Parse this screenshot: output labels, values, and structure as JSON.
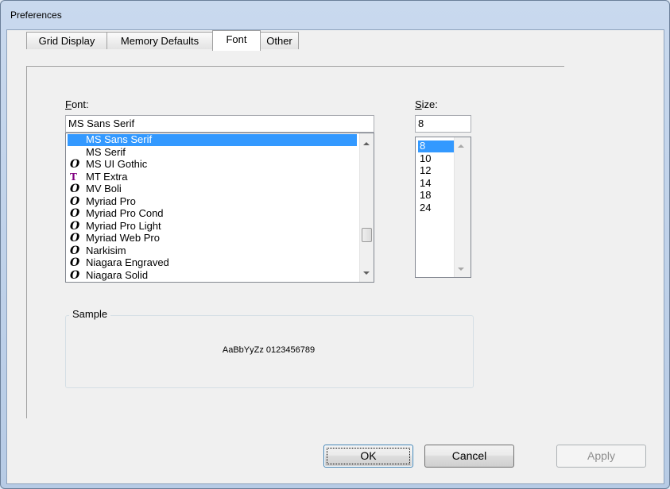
{
  "window": {
    "title": "Preferences"
  },
  "tabs": [
    {
      "label": "Grid Display"
    },
    {
      "label": "Memory Defaults"
    },
    {
      "label": "Font",
      "active": true
    },
    {
      "label": "Other"
    }
  ],
  "font": {
    "label_underlined": "F",
    "label_rest": "ont:",
    "value": "MS Sans Serif",
    "items": [
      {
        "name": "MS Sans Serif",
        "icon": "",
        "selected": true
      },
      {
        "name": "MS Serif",
        "icon": ""
      },
      {
        "name": "MS UI Gothic",
        "icon": "opentype-icon"
      },
      {
        "name": "MT Extra",
        "icon": "truetype-icon"
      },
      {
        "name": "MV Boli",
        "icon": "opentype-icon"
      },
      {
        "name": "Myriad Pro",
        "icon": "opentype-icon"
      },
      {
        "name": "Myriad Pro Cond",
        "icon": "opentype-icon"
      },
      {
        "name": "Myriad Pro Light",
        "icon": "opentype-icon"
      },
      {
        "name": "Myriad Web Pro",
        "icon": "opentype-icon"
      },
      {
        "name": "Narkisim",
        "icon": "opentype-icon"
      },
      {
        "name": "Niagara Engraved",
        "icon": "opentype-icon"
      },
      {
        "name": "Niagara Solid",
        "icon": "opentype-icon"
      }
    ]
  },
  "size": {
    "label_underlined": "S",
    "label_rest": "ize:",
    "value": "8",
    "items": [
      "8",
      "10",
      "12",
      "14",
      "18",
      "24"
    ],
    "selected": "8"
  },
  "sample": {
    "title": "Sample",
    "text": "AaBbYyZz 0123456789"
  },
  "buttons": {
    "ok": "OK",
    "cancel": "Cancel",
    "apply": "Apply"
  },
  "icons": {
    "opentype": "O",
    "truetype": "T"
  },
  "colors": {
    "selection": "#3399ff",
    "truetype_icon": "#800080"
  }
}
